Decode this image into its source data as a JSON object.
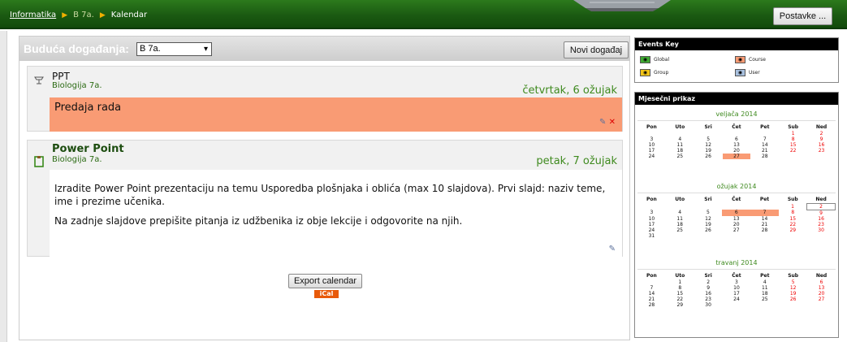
{
  "header": {
    "breadcrumb": [
      "Informatika",
      "B 7a.",
      "Kalendar"
    ],
    "settings_button": "Postavke ..."
  },
  "upcoming": {
    "title": "Buduća događanja:",
    "course_select": "B 7a.",
    "new_event_button": "Novi događaj",
    "events": [
      {
        "name": "PPT",
        "course": "Biologija 7a.",
        "date": "četvrtak, 6 ožujak",
        "description": [
          "Predaja rada"
        ],
        "icon": "assignment-icon",
        "highlight": "#f99b74"
      },
      {
        "name": "Power Point",
        "course": "Biologija 7a.",
        "date": "petak, 7 ožujak",
        "description": [
          "Izradite Power Point prezentaciju na temu Usporedba plošnjaka i oblića (max 10 slajdova). Prvi slajd: naziv teme, ime i prezime učenika.",
          "Na zadnje slajdove prepišite pitanja iz udžbenika iz obje lekcije i odgovorite na njih."
        ],
        "icon": "quiz-icon"
      }
    ],
    "export_button": "Export calendar",
    "ical_badge": "iCal"
  },
  "events_key": {
    "title": "Events Key",
    "items": [
      {
        "label": "Global",
        "color": "#3fa832"
      },
      {
        "label": "Course",
        "color": "#f99b74"
      },
      {
        "label": "Group",
        "color": "#f2c418"
      },
      {
        "label": "User",
        "color": "#a8c0de"
      }
    ]
  },
  "monthly_view": {
    "title": "Mjesečni prikaz",
    "weekdays": [
      "Pon",
      "Uto",
      "Sri",
      "Čet",
      "Pet",
      "Sub",
      "Ned"
    ],
    "months": [
      {
        "name": "veljača 2014",
        "weeks": [
          [
            "",
            "",
            "",
            "",
            "",
            "1",
            "2"
          ],
          [
            "3",
            "4",
            "5",
            "6",
            "7",
            "8",
            "9"
          ],
          [
            "10",
            "11",
            "12",
            "13",
            "14",
            "15",
            "16"
          ],
          [
            "17",
            "18",
            "19",
            "20",
            "21",
            "22",
            "23"
          ],
          [
            "24",
            "25",
            "26",
            "27",
            "28",
            "",
            ""
          ]
        ],
        "event_days": [
          "27"
        ],
        "today": ""
      },
      {
        "name": "ožujak 2014",
        "weeks": [
          [
            "",
            "",
            "",
            "",
            "",
            "1",
            "2"
          ],
          [
            "3",
            "4",
            "5",
            "6",
            "7",
            "8",
            "9"
          ],
          [
            "10",
            "11",
            "12",
            "13",
            "14",
            "15",
            "16"
          ],
          [
            "17",
            "18",
            "19",
            "20",
            "21",
            "22",
            "23"
          ],
          [
            "24",
            "25",
            "26",
            "27",
            "28",
            "29",
            "30"
          ],
          [
            "31",
            "",
            "",
            "",
            "",
            "",
            ""
          ]
        ],
        "event_days": [
          "6",
          "7"
        ],
        "today": "2"
      },
      {
        "name": "travanj 2014",
        "weeks": [
          [
            "",
            "1",
            "2",
            "3",
            "4",
            "5",
            "6"
          ],
          [
            "7",
            "8",
            "9",
            "10",
            "11",
            "12",
            "13"
          ],
          [
            "14",
            "15",
            "16",
            "17",
            "18",
            "19",
            "20"
          ],
          [
            "21",
            "22",
            "23",
            "24",
            "25",
            "26",
            "27"
          ],
          [
            "28",
            "29",
            "30",
            "",
            "",
            "",
            ""
          ]
        ],
        "event_days": [],
        "today": ""
      }
    ]
  }
}
